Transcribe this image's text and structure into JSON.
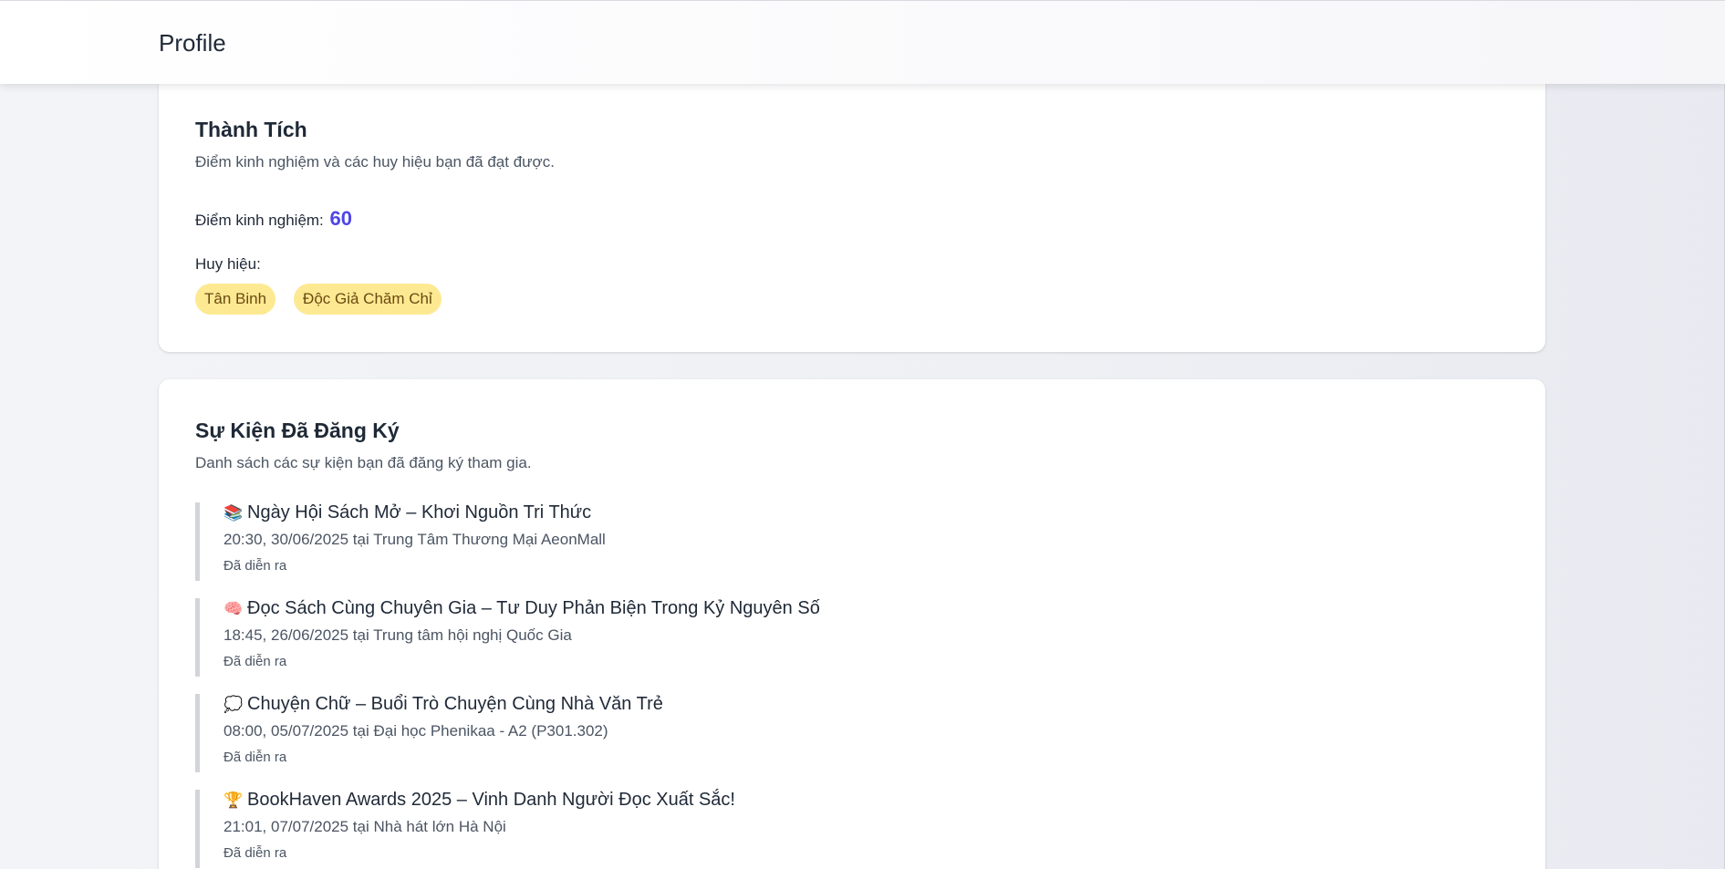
{
  "header": {
    "title": "Profile"
  },
  "achievements": {
    "title": "Thành Tích",
    "description": "Điểm kinh nghiệm và các huy hiệu bạn đã đạt được.",
    "exp_label": "Điểm kinh nghiệm:",
    "exp_value": "60",
    "badges_label": "Huy hiệu:",
    "badges": [
      "Tân Binh",
      "Độc Giả Chăm Chỉ"
    ]
  },
  "events": {
    "title": "Sự Kiện Đã Đăng Ký",
    "description": "Danh sách các sự kiện bạn đã đăng ký tham gia.",
    "items": [
      {
        "icon": "📚",
        "icon_name": "books-icon",
        "title": "Ngày Hội Sách Mở – Khơi Nguồn Tri Thức",
        "meta": "20:30, 30/06/2025 tại Trung Tâm Thương Mại AeonMall",
        "status": "Đã diễn ra"
      },
      {
        "icon": "🧠",
        "icon_name": "brain-icon",
        "title": "Đọc Sách Cùng Chuyên Gia – Tư Duy Phản Biện Trong Kỷ Nguyên Số",
        "meta": "18:45, 26/06/2025 tại Trung tâm hội nghị Quốc Gia",
        "status": "Đã diễn ra"
      },
      {
        "icon": "💭",
        "icon_name": "speech-bubble-icon",
        "title": "Chuyện Chữ – Buổi Trò Chuyện Cùng Nhà Văn Trẻ",
        "meta": "08:00, 05/07/2025 tại Đại học Phenikaa - A2 (P301.302)",
        "status": "Đã diễn ra"
      },
      {
        "icon": "🏆",
        "icon_name": "trophy-icon",
        "title": "BookHaven Awards 2025 – Vinh Danh Người Đọc Xuất Sắc!",
        "meta": "21:01, 07/07/2025 tại Nhà hát lớn Hà Nội",
        "status": "Đã diễn ra"
      }
    ]
  },
  "colors": {
    "accent": "#4f46e5",
    "badge_bg": "#fde992",
    "badge_text": "#6b4a12",
    "event_border": "#d1d5db"
  }
}
